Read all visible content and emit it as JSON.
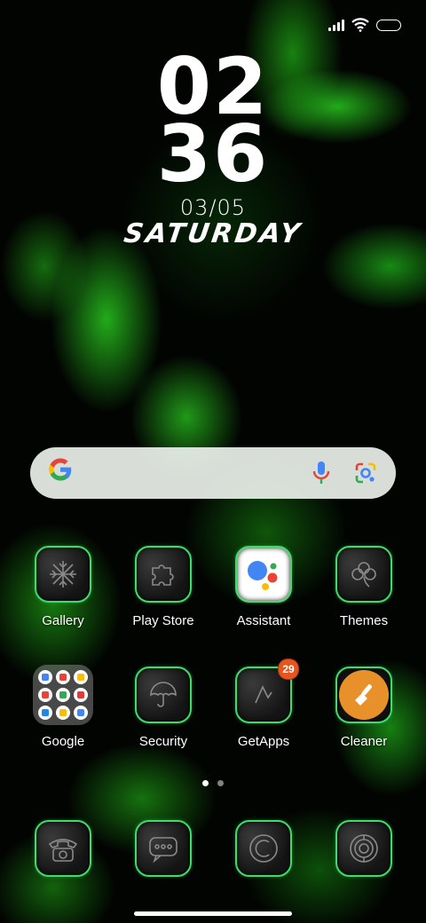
{
  "status_bar": {
    "signal_icon": "cellular-signal-icon",
    "wifi_icon": "wifi-icon",
    "battery_icon": "battery-icon"
  },
  "clock": {
    "hours": "02",
    "minutes": "36",
    "date": "03/05",
    "day": "SATURDAY"
  },
  "search_bar": {
    "logo": "G",
    "mic_icon": "microphone-icon",
    "lens_icon": "lens-camera-icon"
  },
  "apps_row1": [
    {
      "label": "Gallery",
      "icon": "snowflake-icon"
    },
    {
      "label": "Play Store",
      "icon": "puzzle-icon"
    },
    {
      "label": "Assistant",
      "icon": "google-assistant-icon"
    },
    {
      "label": "Themes",
      "icon": "clover-icon"
    }
  ],
  "apps_row2": [
    {
      "label": "Google",
      "icon": "folder-icon"
    },
    {
      "label": "Security",
      "icon": "umbrella-icon"
    },
    {
      "label": "GetApps",
      "icon": "getapps-icon",
      "badge": "29"
    },
    {
      "label": "Cleaner",
      "icon": "broom-icon"
    }
  ],
  "page_indicator": {
    "pages": 2,
    "current": 1
  },
  "dock": [
    {
      "icon": "phone-icon"
    },
    {
      "icon": "message-icon"
    },
    {
      "icon": "browser-icon"
    },
    {
      "icon": "camera-icon"
    }
  ],
  "colors": {
    "tile_border": "#3ddc6b",
    "badge": "#e8541e",
    "cleaner": "#e8902a"
  }
}
